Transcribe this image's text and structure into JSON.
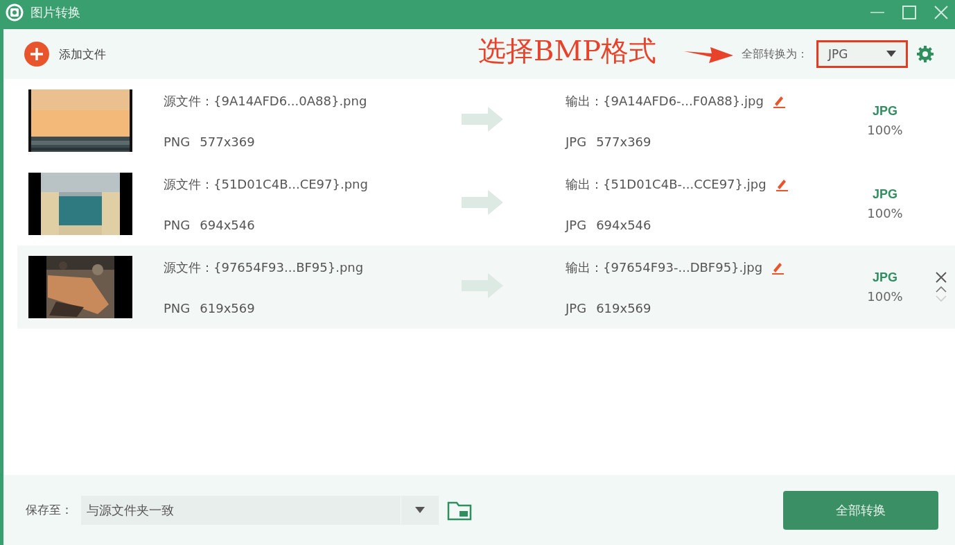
{
  "window": {
    "title": "图片转换"
  },
  "toolbar": {
    "add_button": "添加文件",
    "convert_all_label": "全部转换为：",
    "format": "JPG"
  },
  "annotation": {
    "text": "选择BMP格式"
  },
  "files": [
    {
      "source": "源文件：{9A14AFD6...0A88}.png",
      "source_format": "PNG",
      "source_size": "577x369",
      "output": "输出：{9A14AFD6-...F0A88}.jpg",
      "output_format": "JPG",
      "output_size": "577x369",
      "target": "JPG",
      "progress": "100%",
      "hovered": false
    },
    {
      "source": "源文件：{51D01C4B...CE97}.png",
      "source_format": "PNG",
      "source_size": "694x546",
      "output": "输出：{51D01C4B-...CCE97}.jpg",
      "output_format": "JPG",
      "output_size": "694x546",
      "target": "JPG",
      "progress": "100%",
      "hovered": false
    },
    {
      "source": "源文件：{97654F93...BF95}.png",
      "source_format": "PNG",
      "source_size": "619x569",
      "output": "输出：{97654F93-...DBF95}.jpg",
      "output_format": "JPG",
      "output_size": "619x569",
      "target": "JPG",
      "progress": "100%",
      "hovered": true
    }
  ],
  "footer": {
    "save_label": "保存至：",
    "save_path": "与源文件夹一致",
    "convert_button": "全部转换"
  }
}
